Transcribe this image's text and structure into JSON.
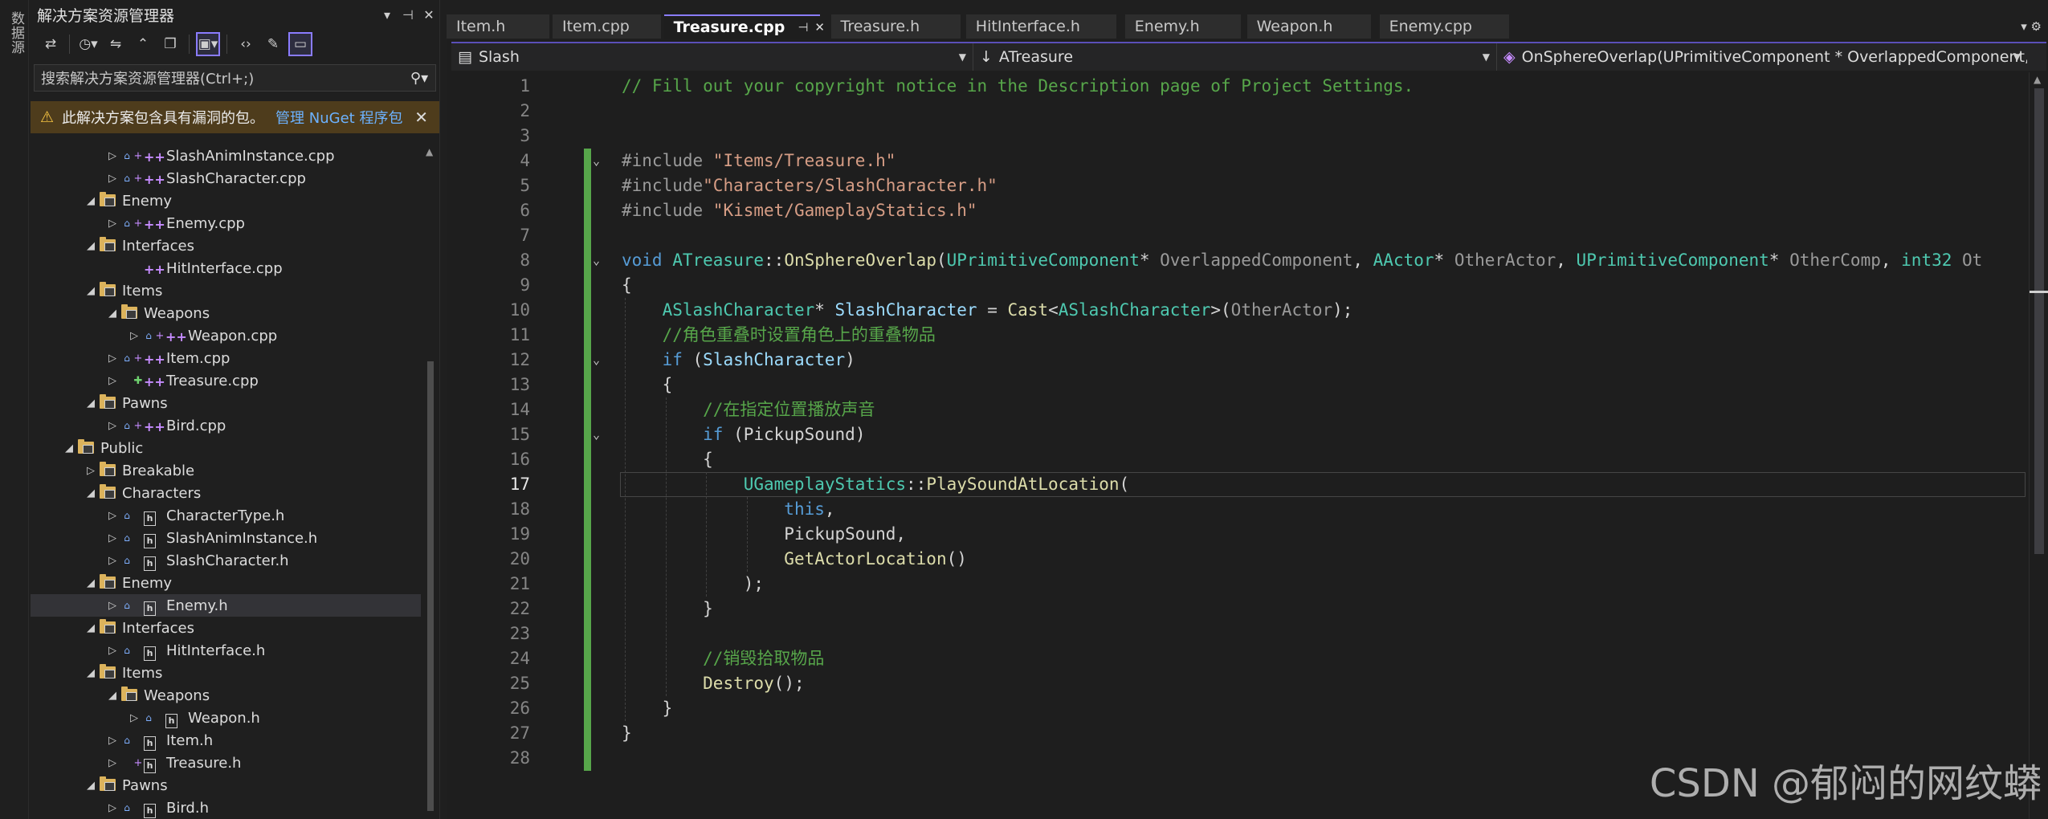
{
  "left_strip": {
    "label": "数据源"
  },
  "solution_explorer": {
    "title": "解决方案资源管理器",
    "title_controls": [
      "▾",
      "⊣",
      "✕"
    ],
    "search_placeholder": "搜索解决方案资源管理器(Ctrl+;)",
    "warning_text": "此解决方案包含具有漏洞的包。",
    "warning_link": "管理 NuGet 程序包",
    "tree": [
      {
        "label": "SlashAnimInstance.cpp",
        "kind": "cpp",
        "depth": 3,
        "arrow": "▷",
        "lock": true,
        "mark": "+"
      },
      {
        "label": "SlashCharacter.cpp",
        "kind": "cpp",
        "depth": 3,
        "arrow": "▷",
        "lock": true,
        "mark": "+"
      },
      {
        "label": "Enemy",
        "kind": "folder",
        "depth": 2,
        "arrow": "◢"
      },
      {
        "label": "Enemy.cpp",
        "kind": "cpp",
        "depth": 3,
        "arrow": "▷",
        "lock": true,
        "mark": "+"
      },
      {
        "label": "Interfaces",
        "kind": "folder",
        "depth": 2,
        "arrow": "◢"
      },
      {
        "label": "HitInterface.cpp",
        "kind": "cpp",
        "depth": 3,
        "arrow": "",
        "lock": false,
        "mark": ""
      },
      {
        "label": "Items",
        "kind": "folder",
        "depth": 2,
        "arrow": "◢"
      },
      {
        "label": "Weapons",
        "kind": "folder",
        "depth": 3,
        "arrow": "◢"
      },
      {
        "label": "Weapon.cpp",
        "kind": "cpp",
        "depth": 4,
        "arrow": "▷",
        "lock": true,
        "mark": "+"
      },
      {
        "label": "Item.cpp",
        "kind": "cpp",
        "depth": 3,
        "arrow": "▷",
        "lock": true,
        "mark": "+"
      },
      {
        "label": "Treasure.cpp",
        "kind": "cpp",
        "depth": 3,
        "arrow": "▷",
        "lock": false,
        "mark": "*"
      },
      {
        "label": "Pawns",
        "kind": "folder",
        "depth": 2,
        "arrow": "◢"
      },
      {
        "label": "Bird.cpp",
        "kind": "cpp",
        "depth": 3,
        "arrow": "▷",
        "lock": true,
        "mark": "+"
      },
      {
        "label": "Public",
        "kind": "folder",
        "depth": 1,
        "arrow": "◢"
      },
      {
        "label": "Breakable",
        "kind": "folder",
        "depth": 2,
        "arrow": "▷"
      },
      {
        "label": "Characters",
        "kind": "folder",
        "depth": 2,
        "arrow": "◢"
      },
      {
        "label": "CharacterType.h",
        "kind": "h",
        "depth": 3,
        "arrow": "▷",
        "lock": true,
        "mark": ""
      },
      {
        "label": "SlashAnimInstance.h",
        "kind": "h",
        "depth": 3,
        "arrow": "▷",
        "lock": true,
        "mark": ""
      },
      {
        "label": "SlashCharacter.h",
        "kind": "h",
        "depth": 3,
        "arrow": "▷",
        "lock": true,
        "mark": ""
      },
      {
        "label": "Enemy",
        "kind": "folder",
        "depth": 2,
        "arrow": "◢"
      },
      {
        "label": "Enemy.h",
        "kind": "h",
        "depth": 3,
        "arrow": "▷",
        "lock": true,
        "mark": "",
        "selected": true
      },
      {
        "label": "Interfaces",
        "kind": "folder",
        "depth": 2,
        "arrow": "◢"
      },
      {
        "label": "HitInterface.h",
        "kind": "h",
        "depth": 3,
        "arrow": "▷",
        "lock": true,
        "mark": ""
      },
      {
        "label": "Items",
        "kind": "folder",
        "depth": 2,
        "arrow": "◢"
      },
      {
        "label": "Weapons",
        "kind": "folder",
        "depth": 3,
        "arrow": "◢"
      },
      {
        "label": "Weapon.h",
        "kind": "h",
        "depth": 4,
        "arrow": "▷",
        "lock": true,
        "mark": ""
      },
      {
        "label": "Item.h",
        "kind": "h",
        "depth": 3,
        "arrow": "▷",
        "lock": true,
        "mark": ""
      },
      {
        "label": "Treasure.h",
        "kind": "h",
        "depth": 3,
        "arrow": "▷",
        "lock": false,
        "mark": "+"
      },
      {
        "label": "Pawns",
        "kind": "folder",
        "depth": 2,
        "arrow": "◢"
      },
      {
        "label": "Bird.h",
        "kind": "h",
        "depth": 3,
        "arrow": "▷",
        "lock": true,
        "mark": ""
      }
    ]
  },
  "editor": {
    "tabs": [
      {
        "label": "Item.h",
        "active": false
      },
      {
        "label": "Item.cpp",
        "active": false
      },
      {
        "label": "Treasure.cpp",
        "active": true,
        "pin": "⊣",
        "close": "✕"
      },
      {
        "label": "Treasure.h",
        "active": false
      },
      {
        "label": "HitInterface.h",
        "active": false
      },
      {
        "label": "Enemy.h",
        "active": false
      },
      {
        "label": "Weapon.h",
        "active": false
      },
      {
        "label": "Enemy.cpp",
        "active": false
      }
    ],
    "tab_right_controls": "▾ ⚙",
    "nav": {
      "project": "Slash",
      "scope": "ATreasure",
      "member": "OnSphereOverlap(UPrimitiveComponent * OverlappedComponent, A"
    },
    "current_line": 17,
    "code_lines": [
      {
        "n": "1",
        "segs": [
          {
            "t": "// Fill out your copyright notice in the Description page of Project Settings.",
            "c": "com"
          }
        ]
      },
      {
        "n": "2",
        "segs": []
      },
      {
        "n": "3",
        "segs": []
      },
      {
        "n": "4",
        "fold": true,
        "segs": [
          {
            "t": "#include ",
            "c": "pp"
          },
          {
            "t": "\"Items/Treasure.h\"",
            "c": "str"
          }
        ]
      },
      {
        "n": "5",
        "segs": [
          {
            "t": "#include",
            "c": "pp"
          },
          {
            "t": "\"Characters/SlashCharacter.h\"",
            "c": "str"
          }
        ]
      },
      {
        "n": "6",
        "segs": [
          {
            "t": "#include ",
            "c": "pp"
          },
          {
            "t": "\"Kismet/GameplayStatics.h\"",
            "c": "str"
          }
        ]
      },
      {
        "n": "7",
        "segs": []
      },
      {
        "n": "8",
        "fold": true,
        "segs": [
          {
            "t": "void ",
            "c": "kw"
          },
          {
            "t": "ATreasure",
            "c": "type"
          },
          {
            "t": "::",
            "c": "plain"
          },
          {
            "t": "OnSphereOverlap",
            "c": "fn"
          },
          {
            "t": "(",
            "c": "plain"
          },
          {
            "t": "UPrimitiveComponent",
            "c": "type"
          },
          {
            "t": "* ",
            "c": "plain"
          },
          {
            "t": "OverlappedComponent",
            "c": "param"
          },
          {
            "t": ", ",
            "c": "plain"
          },
          {
            "t": "AActor",
            "c": "type"
          },
          {
            "t": "* ",
            "c": "plain"
          },
          {
            "t": "OtherActor",
            "c": "param"
          },
          {
            "t": ", ",
            "c": "plain"
          },
          {
            "t": "UPrimitiveComponent",
            "c": "type"
          },
          {
            "t": "* ",
            "c": "plain"
          },
          {
            "t": "OtherComp",
            "c": "param"
          },
          {
            "t": ", ",
            "c": "plain"
          },
          {
            "t": "int32",
            "c": "type"
          },
          {
            "t": " Ot",
            "c": "param"
          }
        ]
      },
      {
        "n": "9",
        "segs": [
          {
            "t": "{",
            "c": "plain"
          }
        ]
      },
      {
        "n": "10",
        "segs": [
          {
            "t": "    ",
            "c": "plain"
          },
          {
            "t": "ASlashCharacter",
            "c": "type"
          },
          {
            "t": "* ",
            "c": "plain"
          },
          {
            "t": "SlashCharacter",
            "c": "var"
          },
          {
            "t": " = ",
            "c": "plain"
          },
          {
            "t": "Cast",
            "c": "fn"
          },
          {
            "t": "<",
            "c": "plain"
          },
          {
            "t": "ASlashCharacter",
            "c": "type"
          },
          {
            "t": ">(",
            "c": "plain"
          },
          {
            "t": "OtherActor",
            "c": "param"
          },
          {
            "t": ");",
            "c": "plain"
          }
        ]
      },
      {
        "n": "11",
        "segs": [
          {
            "t": "    //角色重叠时设置角色上的重叠物品",
            "c": "com"
          }
        ]
      },
      {
        "n": "12",
        "fold": true,
        "segs": [
          {
            "t": "    ",
            "c": "plain"
          },
          {
            "t": "if",
            "c": "kw"
          },
          {
            "t": " (",
            "c": "plain"
          },
          {
            "t": "SlashCharacter",
            "c": "var"
          },
          {
            "t": ")",
            "c": "plain"
          }
        ]
      },
      {
        "n": "13",
        "segs": [
          {
            "t": "    {",
            "c": "plain"
          }
        ]
      },
      {
        "n": "14",
        "segs": [
          {
            "t": "        //在指定位置播放声音",
            "c": "com"
          }
        ]
      },
      {
        "n": "15",
        "fold": true,
        "segs": [
          {
            "t": "        ",
            "c": "plain"
          },
          {
            "t": "if",
            "c": "kw"
          },
          {
            "t": " (",
            "c": "plain"
          },
          {
            "t": "PickupSound",
            "c": "plain"
          },
          {
            "t": ")",
            "c": "plain"
          }
        ]
      },
      {
        "n": "16",
        "segs": [
          {
            "t": "        {",
            "c": "plain"
          }
        ]
      },
      {
        "n": "17",
        "segs": [
          {
            "t": "            ",
            "c": "plain"
          },
          {
            "t": "UGameplayStatics",
            "c": "type"
          },
          {
            "t": "::",
            "c": "plain"
          },
          {
            "t": "PlaySoundAtLocation",
            "c": "fn"
          },
          {
            "t": "(",
            "c": "plain"
          }
        ]
      },
      {
        "n": "18",
        "segs": [
          {
            "t": "                ",
            "c": "plain"
          },
          {
            "t": "this",
            "c": "kw"
          },
          {
            "t": ",",
            "c": "plain"
          }
        ]
      },
      {
        "n": "19",
        "segs": [
          {
            "t": "                ",
            "c": "plain"
          },
          {
            "t": "PickupSound",
            "c": "plain"
          },
          {
            "t": ",",
            "c": "plain"
          }
        ]
      },
      {
        "n": "20",
        "segs": [
          {
            "t": "                ",
            "c": "plain"
          },
          {
            "t": "GetActorLocation",
            "c": "fn"
          },
          {
            "t": "()",
            "c": "plain"
          }
        ]
      },
      {
        "n": "21",
        "segs": [
          {
            "t": "            );",
            "c": "plain"
          }
        ]
      },
      {
        "n": "22",
        "segs": [
          {
            "t": "        }",
            "c": "plain"
          }
        ]
      },
      {
        "n": "23",
        "segs": []
      },
      {
        "n": "24",
        "segs": [
          {
            "t": "        //销毁拾取物品",
            "c": "com"
          }
        ]
      },
      {
        "n": "25",
        "segs": [
          {
            "t": "        ",
            "c": "plain"
          },
          {
            "t": "Destroy",
            "c": "fn"
          },
          {
            "t": "();",
            "c": "plain"
          }
        ]
      },
      {
        "n": "26",
        "segs": [
          {
            "t": "    }",
            "c": "plain"
          }
        ]
      },
      {
        "n": "27",
        "segs": [
          {
            "t": "}",
            "c": "plain"
          }
        ]
      },
      {
        "n": "28",
        "segs": []
      }
    ]
  },
  "watermark": "CSDN @郁闷的网纹蟒"
}
